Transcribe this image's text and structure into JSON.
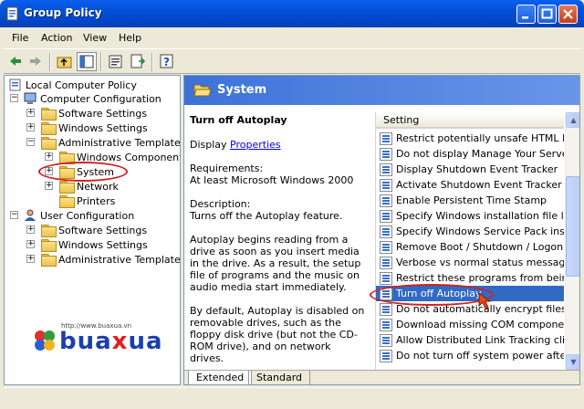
{
  "window": {
    "title": "Group Policy"
  },
  "menu": [
    "File",
    "Action",
    "View",
    "Help"
  ],
  "tree": {
    "root": "Local Computer Policy",
    "items": [
      {
        "label": "Computer Configuration"
      },
      {
        "label": "Software Settings"
      },
      {
        "label": "Windows Settings"
      },
      {
        "label": "Administrative Templates"
      },
      {
        "label": "Windows Components"
      },
      {
        "label": "System"
      },
      {
        "label": "Network"
      },
      {
        "label": "Printers"
      },
      {
        "label": "User Configuration"
      },
      {
        "label": "Software Settings"
      },
      {
        "label": "Windows Settings"
      },
      {
        "label": "Administrative Templates"
      }
    ]
  },
  "logo": {
    "url": "http://www.buaxua.vn",
    "brand_a": "bua",
    "brand_x": "x",
    "brand_b": "ua"
  },
  "pane": {
    "header": "System",
    "description": {
      "heading": "Turn off Autoplay",
      "display_label": "Display ",
      "display_link": "Properties",
      "requirements_label": "Requirements:",
      "requirements_value": "At least Microsoft Windows 2000",
      "description_label": "Description:",
      "description_value": "Turns off the Autoplay feature.",
      "para1": "Autoplay begins reading from a drive as soon as you insert media in the drive. As a result, the setup file of programs and the music on audio media start immediately.",
      "para2": "By default, Autoplay is disabled on removable drives, such as the floppy disk drive (but not the CD-ROM drive), and on network drives."
    },
    "list_header": "Setting",
    "settings": [
      "Restrict potentially unsafe HTML Help",
      "Do not display Manage Your Server pa",
      "Display Shutdown Event Tracker",
      "Activate Shutdown Event Tracker Syst",
      "Enable Persistent Time Stamp",
      "Specify Windows installation file locatio",
      "Specify Windows Service Pack installat",
      "Remove Boot / Shutdown / Logon / Lo",
      "Verbose vs normal status messages",
      "Restrict these programs from being lau",
      "Turn off Autoplay",
      "Do not automatically encrypt files mov",
      "Download missing COM components",
      "Allow Distributed Link Tracking clients t",
      "Do not turn off system power after a W"
    ],
    "selected_setting": "Turn off Autoplay",
    "tabs": [
      "Extended",
      "Standard"
    ]
  }
}
